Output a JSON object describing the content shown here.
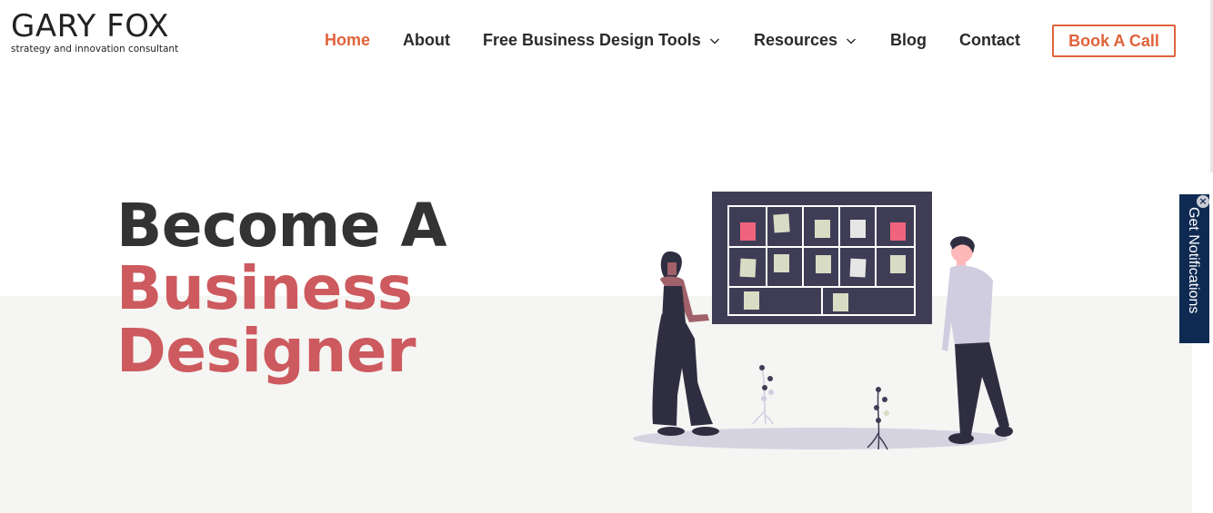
{
  "logo": {
    "name": "GARY FOX",
    "tagline": "strategy and innovation consultant"
  },
  "nav": {
    "items": [
      {
        "label": "Home",
        "active": true
      },
      {
        "label": "About"
      },
      {
        "label": "Free Business Design Tools",
        "has_dropdown": true
      },
      {
        "label": "Resources",
        "has_dropdown": true
      },
      {
        "label": "Blog"
      },
      {
        "label": "Contact"
      }
    ],
    "cta_label": "Book A Call"
  },
  "hero": {
    "line1": "Become A",
    "line2": "Business",
    "line3": "Designer"
  },
  "notification_tab": {
    "label": "Get Notifications",
    "close_symbol": "×"
  },
  "icons": {
    "dropdown": "chevron-down-icon",
    "close": "close-icon"
  },
  "colors": {
    "accent": "#e0633b",
    "hero_highlight": "#cd5a5e",
    "hero_dark": "#333333",
    "band_background": "#f5f5f3",
    "board": "#3f3d56",
    "notification_bg": "#0f2a52"
  }
}
